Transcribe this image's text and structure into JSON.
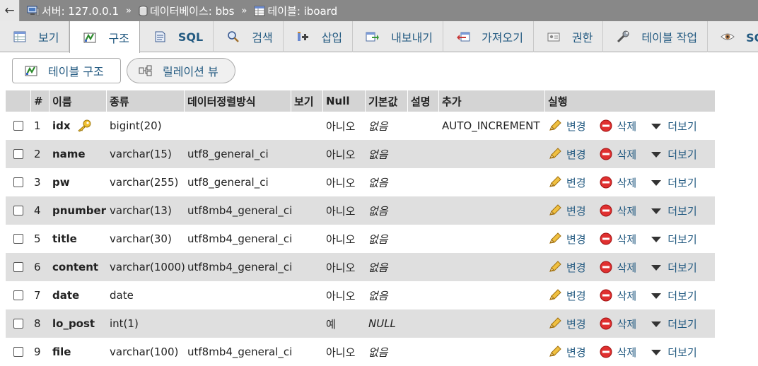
{
  "breadcrumb": {
    "back": "←",
    "server": "서버: 127.0.0.1",
    "database": "데이터베이스: bbs",
    "table": "테이블: iboard",
    "separator": "»"
  },
  "tabs": [
    {
      "label": "보기",
      "icon": "browse-icon"
    },
    {
      "label": "구조",
      "icon": "structure-icon",
      "active": true
    },
    {
      "label": "SQL",
      "icon": "sql-icon"
    },
    {
      "label": "검색",
      "icon": "search-icon"
    },
    {
      "label": "삽입",
      "icon": "insert-icon"
    },
    {
      "label": "내보내기",
      "icon": "export-icon"
    },
    {
      "label": "가져오기",
      "icon": "import-icon"
    },
    {
      "label": "권한",
      "icon": "privileges-icon"
    },
    {
      "label": "테이블 작업",
      "icon": "wrench-icon"
    },
    {
      "label": "SQL 명",
      "icon": "eye-icon"
    }
  ],
  "subnav": {
    "structure": "테이블 구조",
    "relation": "릴레이션 뷰"
  },
  "table": {
    "headers": {
      "num": "#",
      "name": "이름",
      "type": "종류",
      "collation": "데이터정렬방식",
      "attributes": "보기",
      "null": "Null",
      "default": "기본값",
      "comment": "설명",
      "extra": "추가",
      "action": "실행"
    },
    "actions": {
      "change": "변경",
      "drop": "삭제",
      "more": "더보기"
    },
    "rows": [
      {
        "num": "1",
        "name": "idx",
        "type": "bigint(20)",
        "collation": "",
        "null": "아니오",
        "default": "없음",
        "extra": "AUTO_INCREMENT",
        "primary": true
      },
      {
        "num": "2",
        "name": "name",
        "type": "varchar(15)",
        "collation": "utf8_general_ci",
        "null": "아니오",
        "default": "없음",
        "extra": ""
      },
      {
        "num": "3",
        "name": "pw",
        "type": "varchar(255)",
        "collation": "utf8_general_ci",
        "null": "아니오",
        "default": "없음",
        "extra": ""
      },
      {
        "num": "4",
        "name": "pnumber",
        "type": "varchar(13)",
        "collation": "utf8mb4_general_ci",
        "null": "아니오",
        "default": "없음",
        "extra": ""
      },
      {
        "num": "5",
        "name": "title",
        "type": "varchar(30)",
        "collation": "utf8mb4_general_ci",
        "null": "아니오",
        "default": "없음",
        "extra": ""
      },
      {
        "num": "6",
        "name": "content",
        "type": "varchar(1000)",
        "collation": "utf8mb4_general_ci",
        "null": "아니오",
        "default": "없음",
        "extra": ""
      },
      {
        "num": "7",
        "name": "date",
        "type": "date",
        "collation": "",
        "null": "아니오",
        "default": "없음",
        "extra": ""
      },
      {
        "num": "8",
        "name": "lo_post",
        "type": "int(1)",
        "collation": "",
        "null": "예",
        "default": "NULL",
        "extra": ""
      },
      {
        "num": "9",
        "name": "file",
        "type": "varchar(100)",
        "collation": "utf8mb4_general_ci",
        "null": "아니오",
        "default": "없음",
        "extra": ""
      }
    ]
  }
}
